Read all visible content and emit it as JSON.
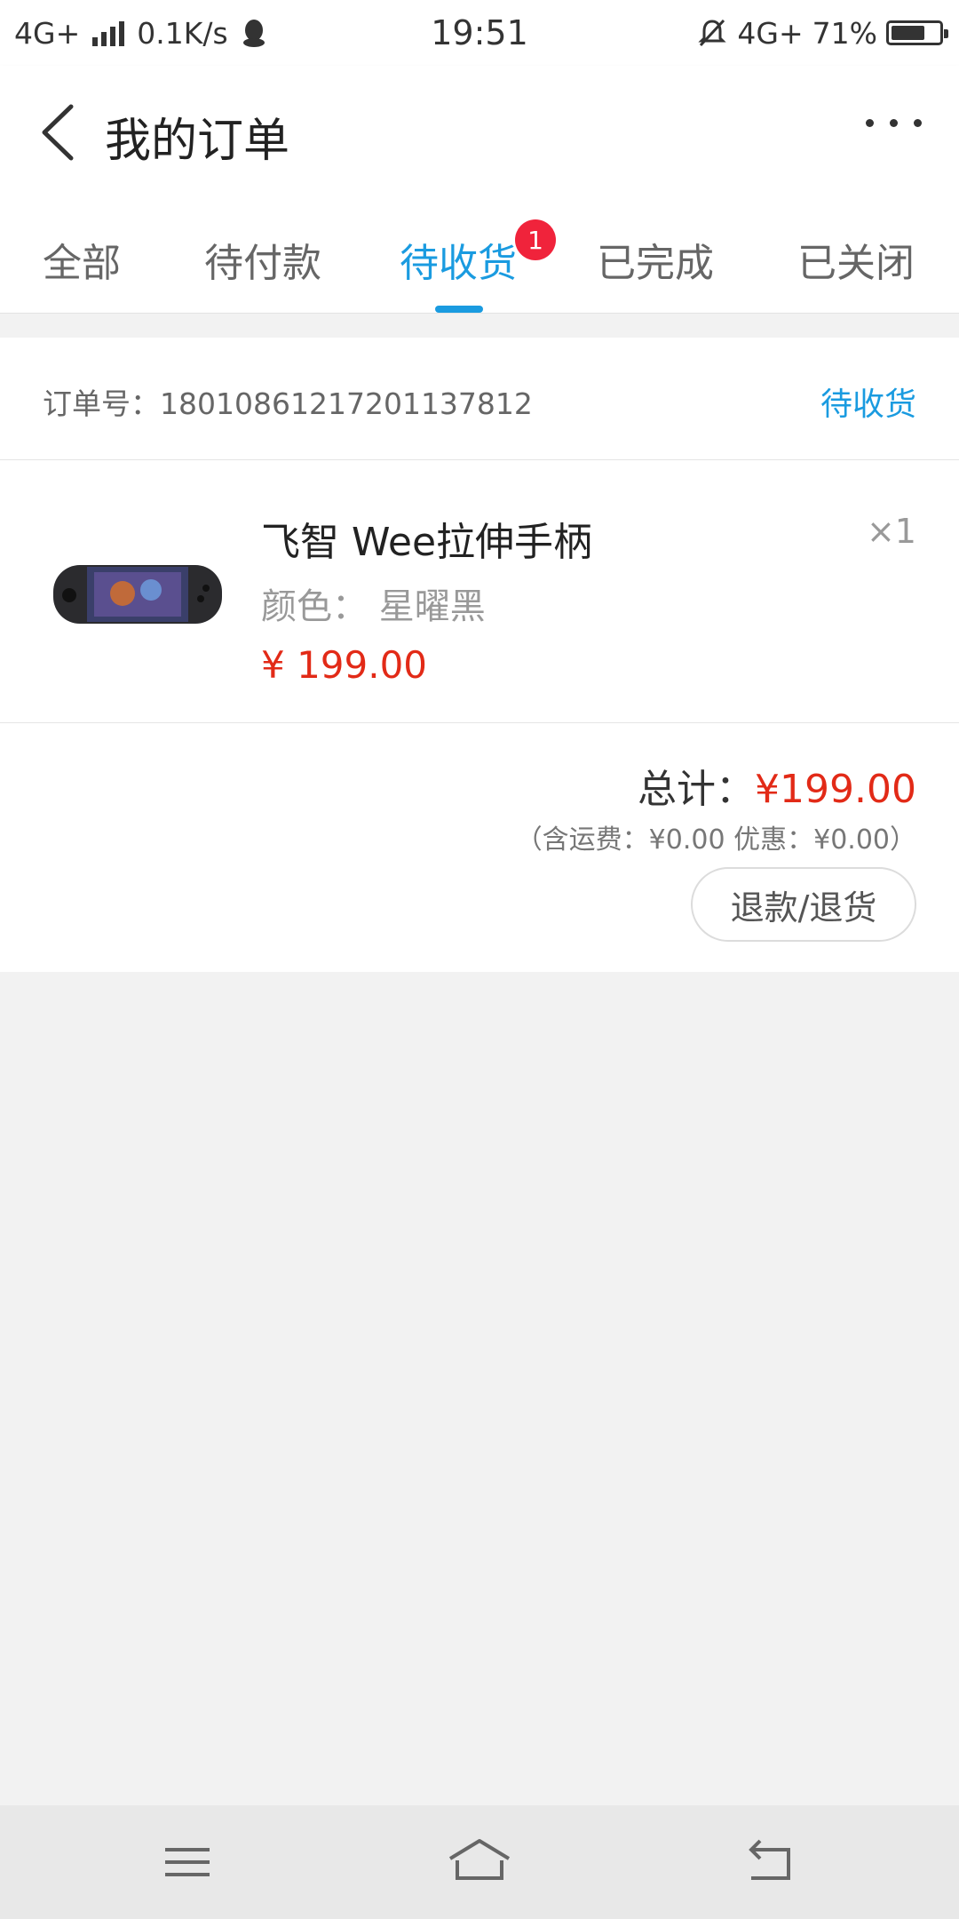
{
  "status_bar": {
    "network_left": "4G+",
    "speed": "0.1K/s",
    "time": "19:51",
    "network_right": "4G+",
    "battery": "71%",
    "battery_level": 0.71,
    "icons": [
      "signal-icon",
      "qq-penguin-icon",
      "mute-bell-icon",
      "battery-icon"
    ]
  },
  "header": {
    "title": "我的订单",
    "back_icon": "chevron-left-icon",
    "more_icon": "more-dots-icon"
  },
  "tabs": [
    {
      "label": "全部",
      "active": false
    },
    {
      "label": "待付款",
      "active": false
    },
    {
      "label": "待收货",
      "active": true
    },
    {
      "label": "已完成",
      "active": false
    },
    {
      "label": "已关闭",
      "active": false
    }
  ],
  "tab_badge": "1",
  "order": {
    "number_label": "订单号: 1801086121720113781 2",
    "number": "订单号：18010861217201137812",
    "status": "待收货",
    "product": {
      "name": "飞智 Wee拉伸手柄",
      "qty": "×1",
      "spec": "颜色：  星曜黑",
      "price": "¥ 199.00",
      "image_icon": "game-controller-image"
    },
    "total_label": "总计：",
    "total_amount": "¥199.00",
    "fee_detail": "（含运费：¥0.00 优惠：¥0.00）",
    "refund_button": "退款/退货"
  },
  "nav": {
    "menu_icon": "menu-icon",
    "home_icon": "home-icon",
    "back_icon": "back-arrow-icon"
  },
  "colors": {
    "accent": "#1a9be0",
    "price": "#e22a17",
    "badge": "#f0233b"
  }
}
